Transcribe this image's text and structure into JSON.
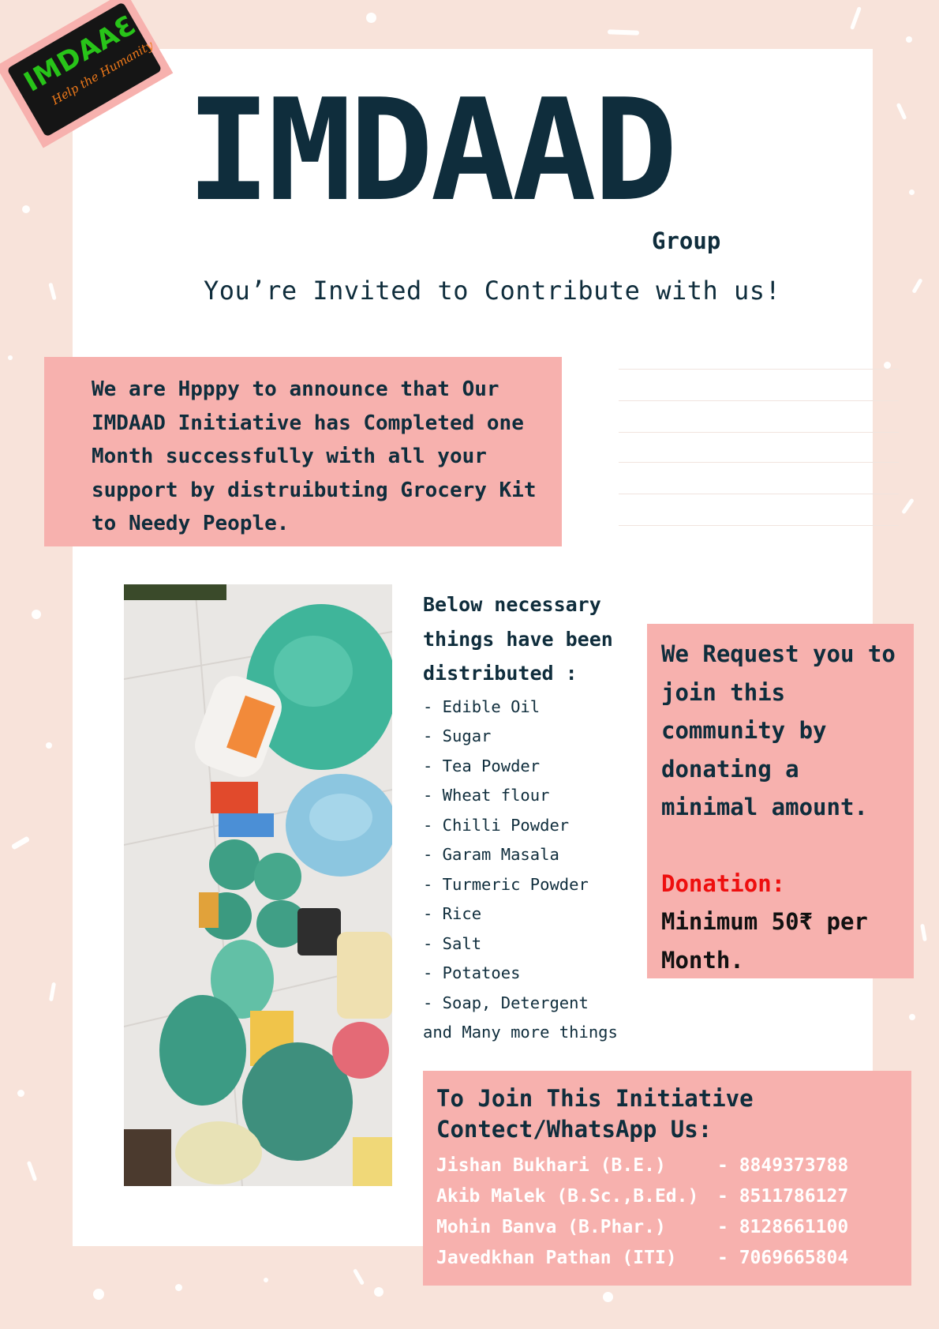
{
  "logo": {
    "wordmark": "IMDAAƐ",
    "tagline": "Help the Humanity"
  },
  "header": {
    "title": "IMDAAD",
    "subtitle": "Group",
    "invite": "You’re Invited to Contribute with us!"
  },
  "announcement": "We are Hpppy to announce that Our IMDAAD Initiative has Completed one Month successfully with all your support by distruibuting Grocery Kit to Needy People.",
  "distribution": {
    "heading": "Below necessary things have been distributed :",
    "items": [
      "- Edible Oil",
      "- Sugar",
      "- Tea Powder",
      "- Wheat flour",
      "- Chilli Powder",
      "- Garam Masala",
      "- Turmeric Powder",
      "- Rice",
      "- Salt",
      "- Potatoes",
      "- Soap, Detergent"
    ],
    "footer": "and Many more things"
  },
  "request": {
    "text": "We Request you to join this community by donating a minimal amount.",
    "donation_label": "Donation:",
    "donation_value": "Minimum 50₹ per Month."
  },
  "contact": {
    "title": "To Join This Initiative Contect/WhatsApp Us:",
    "people": [
      {
        "name": "Jishan Bukhari (B.E.)",
        "phone": "- 8849373788"
      },
      {
        "name": "Akib Malek (B.Sc.,B.Ed.)",
        "phone": "- 8511786127"
      },
      {
        "name": "Mohin Banva (B.Phar.)",
        "phone": "- 8128661100"
      },
      {
        "name": "Javedkhan Pathan (ITI)",
        "phone": "- 7069665804"
      }
    ]
  },
  "colors": {
    "background": "#f8e3da",
    "panel": "#f7b1ae",
    "navy": "#0f2d3c",
    "donation_red": "#ee0f0f",
    "logo_green": "#28c419",
    "logo_orange": "#f07a1a"
  }
}
